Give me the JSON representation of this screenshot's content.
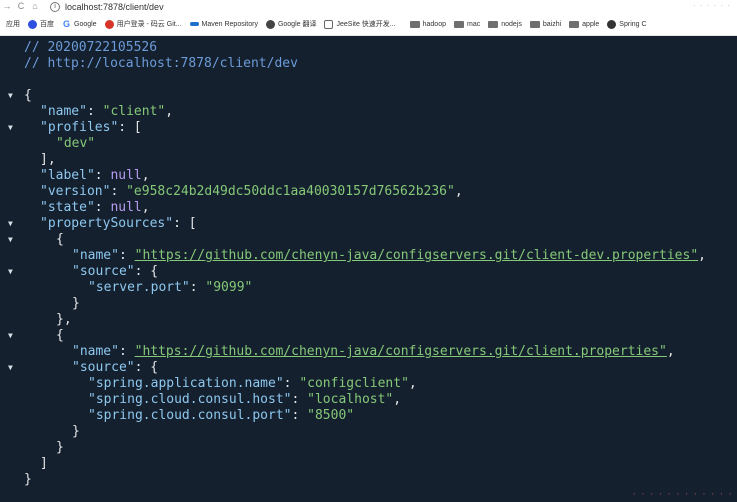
{
  "browser": {
    "nav": {
      "back": "→",
      "forward": "C",
      "home": "⌂"
    },
    "url": "localhost:7878/client/dev",
    "bookmarks": [
      {
        "label": "应用",
        "icon": "apps-icon"
      },
      {
        "label": "百度",
        "icon": "baidu-icon"
      },
      {
        "label": "Google",
        "icon": "google-icon"
      },
      {
        "label": "用户登录 - 码云 Git...",
        "icon": "gitee-icon"
      },
      {
        "label": "Maven Repository",
        "icon": "maven-icon"
      },
      {
        "label": "Google 翻译",
        "icon": "translate-icon"
      },
      {
        "label": "JeeSite 快速开发...",
        "icon": "jeesite-icon"
      },
      {
        "label": "hadoop",
        "icon": "folder-icon"
      },
      {
        "label": "mac",
        "icon": "folder-icon"
      },
      {
        "label": "nodejs",
        "icon": "folder-icon"
      },
      {
        "label": "baizhi",
        "icon": "folder-icon"
      },
      {
        "label": "apple",
        "icon": "folder-icon"
      },
      {
        "label": "Spring C",
        "icon": "spring-icon"
      }
    ]
  },
  "json_view": {
    "comment_time": "// 20200722105526",
    "comment_url": "// http://localhost:7878/client/dev",
    "root": {
      "name_key": "\"name\"",
      "name_val": "\"client\"",
      "profiles_key": "\"profiles\"",
      "profiles_item": "\"dev\"",
      "label_key": "\"label\"",
      "label_val": "null",
      "version_key": "\"version\"",
      "version_val": "\"e958c24b2d49dc50ddc1aa40030157d76562b236\"",
      "state_key": "\"state\"",
      "state_val": "null",
      "ps_key": "\"propertySources\""
    },
    "sources": [
      {
        "name_key": "\"name\"",
        "name_val": "\"https://github.com/chenyn-java/configservers.git/client-dev.properties\"",
        "source_key": "\"source\"",
        "entries": [
          {
            "k": "\"server.port\"",
            "v": "\"9099\""
          }
        ]
      },
      {
        "name_key": "\"name\"",
        "name_val": "\"https://github.com/chenyn-java/configservers.git/client.properties\"",
        "source_key": "\"source\"",
        "entries": [
          {
            "k": "\"spring.application.name\"",
            "v": "\"configclient\""
          },
          {
            "k": "\"spring.cloud.consul.host\"",
            "v": "\"localhost\""
          },
          {
            "k": "\"spring.cloud.consul.port\"",
            "v": "\"8500\""
          }
        ]
      }
    ]
  },
  "colors": {
    "background": "#14202e",
    "comment": "#6c9bd8",
    "key": "#8ec7ef",
    "string": "#85c878",
    "null": "#b99bf0"
  }
}
